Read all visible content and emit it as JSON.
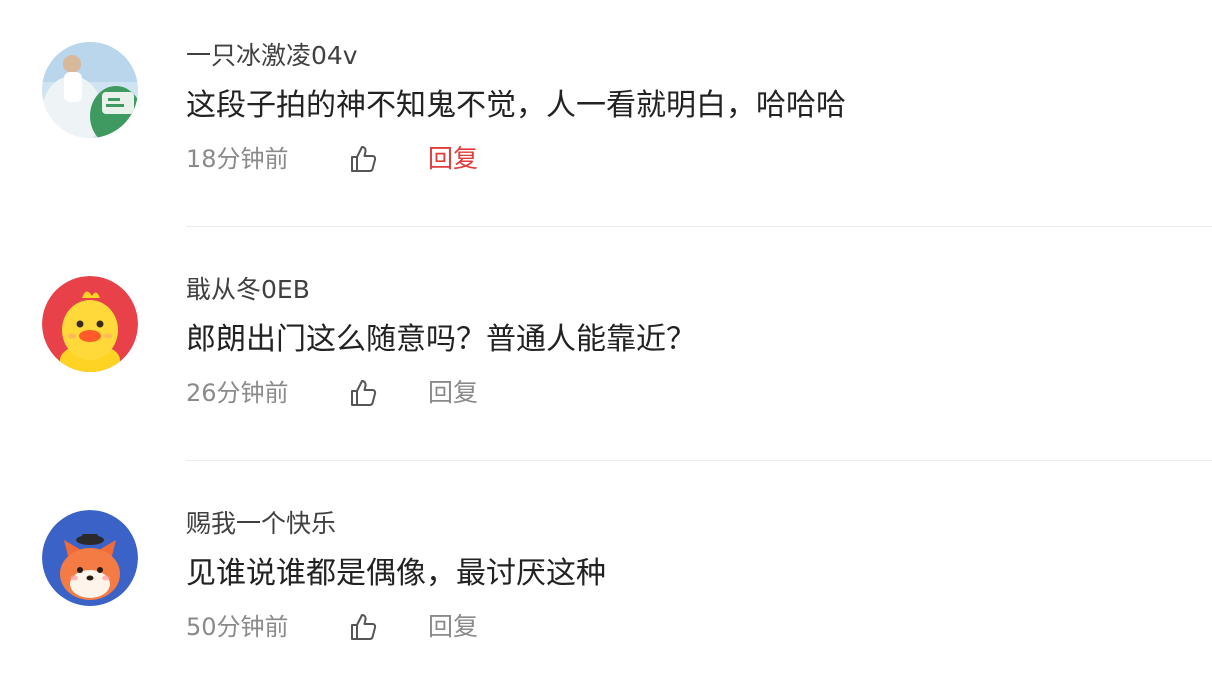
{
  "comments": [
    {
      "username": "一只冰激凌04v",
      "content": "这段子拍的神不知鬼不觉，人一看就明白，哈哈哈",
      "time": "18分钟前",
      "reply_label": "回复",
      "reply_color": "#e03c3c",
      "avatar": "photo-avatar"
    },
    {
      "username": "戢从冬0EB",
      "content": "郎朗出门这么随意吗？普通人能靠近？",
      "time": "26分钟前",
      "reply_label": "回复",
      "reply_color": "#8a8a8a",
      "avatar": "yellow-duck-avatar"
    },
    {
      "username": "赐我一个快乐",
      "content": "见谁说谁都是偶像，最讨厌这种",
      "time": "50分钟前",
      "reply_label": "回复",
      "reply_color": "#8a8a8a",
      "avatar": "fox-avatar"
    }
  ],
  "icons": {
    "like": "thumbs-up-icon"
  }
}
